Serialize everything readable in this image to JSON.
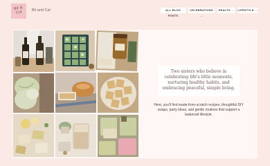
{
  "header": {
    "logo_text": "Bit & Cat",
    "brand_name": "Bit and Cat",
    "nav": [
      {
        "label": "ALL BLOG POSTS"
      },
      {
        "label": "CELEBRATIONS",
        "chevron": "⌄"
      },
      {
        "label": "HEALTH",
        "chevron": "⌄"
      },
      {
        "label": "LIFESTYLE",
        "chevron": "⌄"
      }
    ]
  },
  "gallery": [
    {
      "subject": "olive oil bottles"
    },
    {
      "subject": "seedling tray"
    },
    {
      "subject": "honey jar"
    },
    {
      "subject": "cabbage leaves"
    },
    {
      "subject": "sourdough bread"
    },
    {
      "subject": "crackers"
    },
    {
      "subject": "soap bars"
    },
    {
      "subject": "drink glass"
    },
    {
      "subject": "soap molds"
    }
  ],
  "hero": {
    "tagline": "Two sisters who believe in celebrating life's little moments, nurturing healthy habits, and embracing peaceful, simple living.",
    "description": "Here, you'll find made-from-scratch recipes, thoughtful DIY swaps, party ideas, and gentle routines that support a balanced lifestyle."
  }
}
